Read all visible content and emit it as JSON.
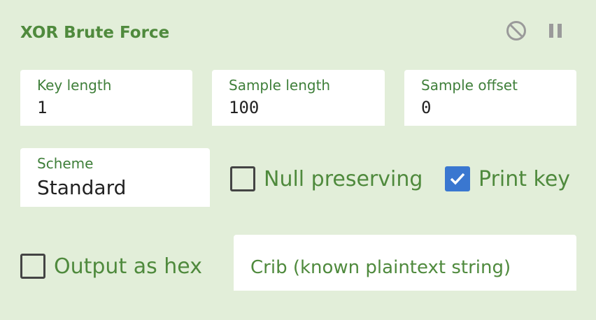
{
  "operation": {
    "title": "XOR Brute Force",
    "icons": {
      "disable": "disable-icon",
      "pause": "pause-icon"
    }
  },
  "fields": {
    "key_length": {
      "label": "Key length",
      "value": "1"
    },
    "sample_length": {
      "label": "Sample length",
      "value": "100"
    },
    "sample_offset": {
      "label": "Sample offset",
      "value": "0"
    },
    "scheme": {
      "label": "Scheme",
      "value": "Standard"
    },
    "crib": {
      "placeholder": "Crib (known plaintext string)",
      "value": ""
    }
  },
  "checkboxes": {
    "null_preserving": {
      "label": "Null preserving",
      "checked": false
    },
    "print_key": {
      "label": "Print key",
      "checked": true
    },
    "output_as_hex": {
      "label": "Output as hex",
      "checked": false
    }
  },
  "colors": {
    "background": "#e2eed9",
    "accent_green": "#4f8a3d",
    "checkbox_checked": "#3a77d0"
  }
}
